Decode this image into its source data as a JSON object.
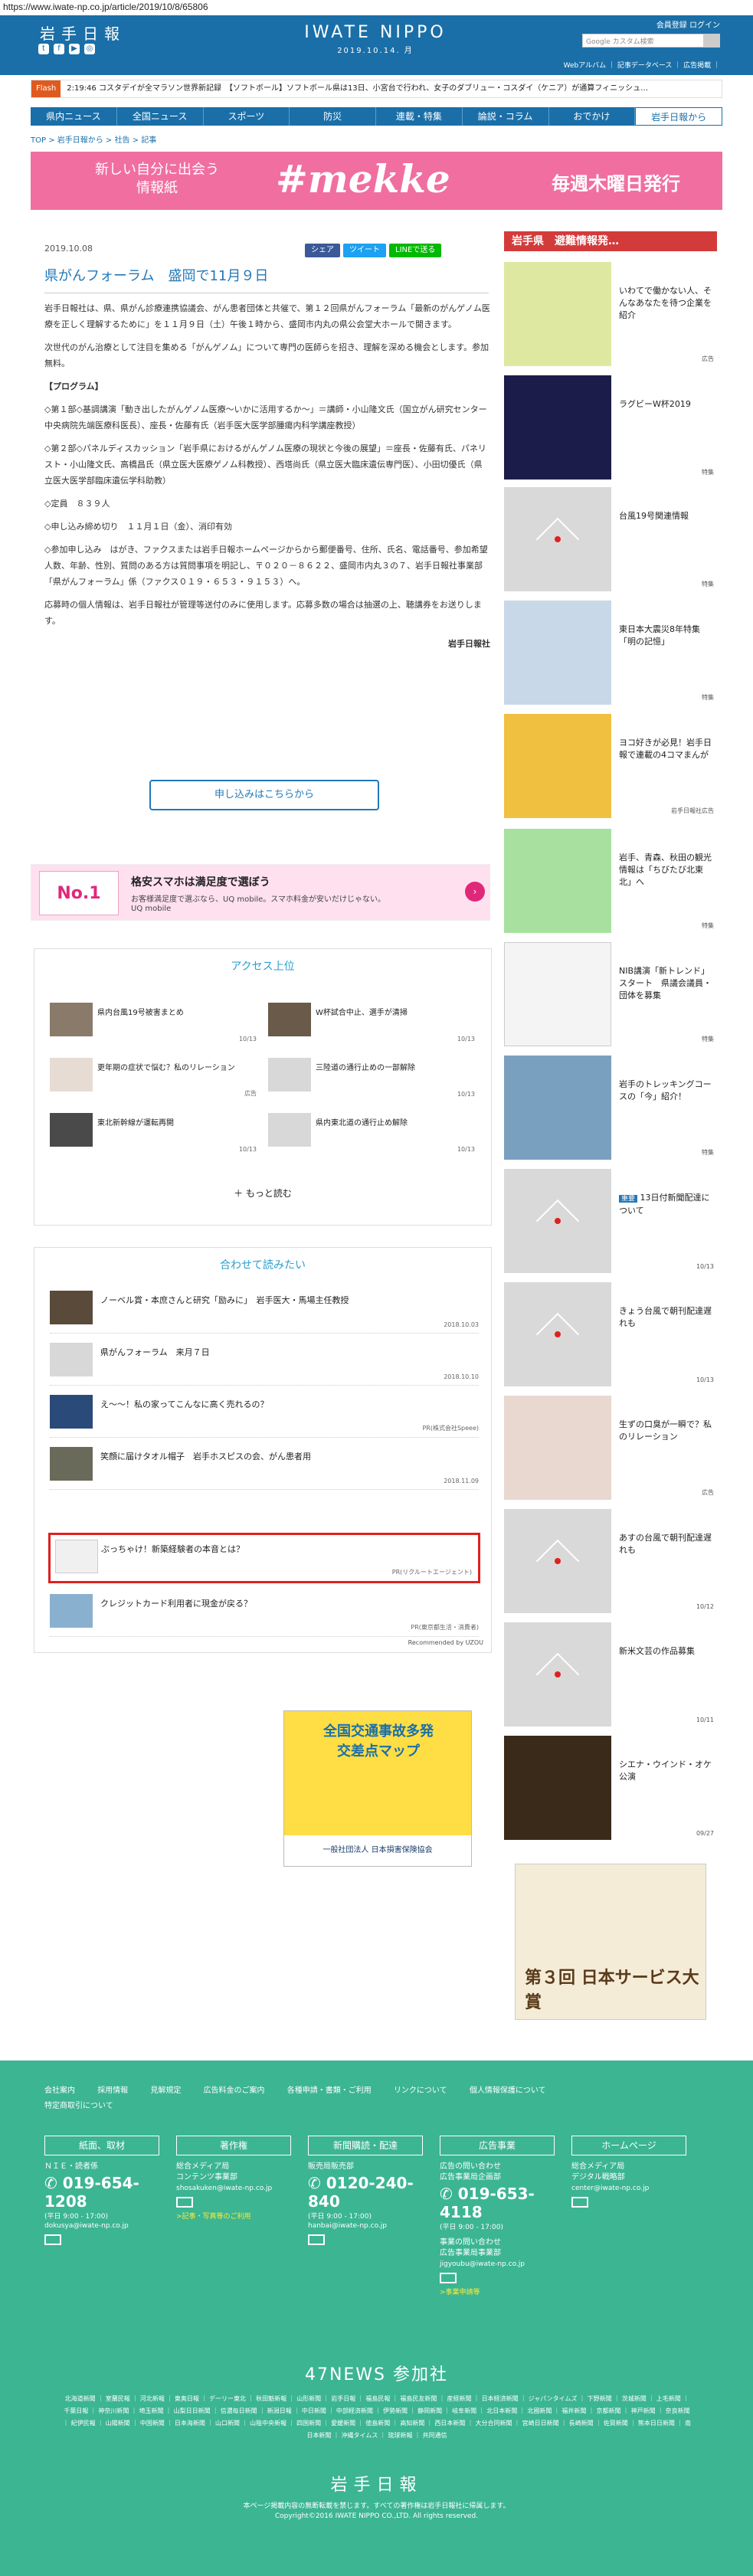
{
  "url": "https://www.iwate-np.co.jp/article/2019/10/8/65806",
  "header": {
    "logo": "岩手日報",
    "brand": "IWATE NIPPO",
    "date": "2019.10.14. 月",
    "member_links": "会員登録  ログイン",
    "search_placeholder": "Google カスタム検索",
    "sub_links": "Webアルバム ｜ 記事データベース ｜ 広告掲載 ｜"
  },
  "flash": {
    "tag": "Flash",
    "text": "2:19:46 コスタデイが全マラソン世界新記録　【ソフトボール】ソフトボール県は13日、小宮台で行われ、女子のダブリュー・コスダイ（ケニア）が通算フィニッシュ…"
  },
  "nav": [
    "県内ニュース",
    "全国ニュース",
    "スポーツ",
    "防災",
    "連載・特集",
    "論説・コラム",
    "おでかけ",
    "岩手日報から"
  ],
  "breadcrumb": "TOP > 岩手日報から > 社告 > 記事",
  "banner": {
    "left": "新しい自分に出会う\n情報紙",
    "center": "#mekke",
    "right": "毎週木曜日発行"
  },
  "article": {
    "date": "2019.10.08",
    "share": [
      "シェア",
      "ツイート",
      "LINEで送る"
    ],
    "title": "県がんフォーラム　盛岡で11月９日",
    "paragraphs": [
      "岩手日報社は、県、県がん診療連携協議会、がん患者団体と共催で、第１２回県がんフォーラム「最新のがんゲノム医療を正しく理解するために」を１１月９日（土）午後１時から、盛岡市内丸の県公会堂大ホールで開きます。",
      "次世代のがん治療として注目を集める「がんゲノム」について専門の医師らを招き、理解を深める機会とします。参加無料。",
      "【プログラム】",
      "◇第１部◇基調講演「動き出したがんゲノム医療～いかに活用するか～」＝講師・小山隆文氏（国立がん研究センター中央病院先端医療科医長）、座長・佐藤有氏（岩手医大医学部腫瘍内科学講座教授）",
      "◇第２部◇パネルディスカッション「岩手県におけるがんゲノム医療の現状と今後の展望」＝座長・佐藤有氏、パネリスト・小山隆文氏、高橋昌氏（県立医大医療ゲノム科教授）、西塔尚氏（県立医大臨床遺伝専門医）、小田切優氏（県立医大医学部臨床遺伝学科助教）",
      "◇定員　８３９人",
      "◇申し込み締め切り　１１月１日（金）、消印有効",
      "◇参加申し込み　はがき、ファクスまたは岩手日報ホームページからから郵便番号、住所、氏名、電話番号、参加希望人数、年齢、性別、質問のある方は質問事項を明記し、〒０２０－８６２２、盛岡市内丸３の７、岩手日報社事業部「県がんフォーラム」係（ファクス０１９・６５３・９１５３）へ。",
      "応募時の個人情報は、岩手日報社が管理等送付のみに使用します。応募多数の場合は抽選の上、聴講券をお送りします。"
    ],
    "source": "岩手日報社",
    "apply_button": "申し込みはこちらから"
  },
  "inline_ad": {
    "title": "格安スマホは満足度で選ぼう",
    "desc": "お客様満足度で選ぶなら、UQ mobile。スマホ料金が安いだけじゃない。",
    "brand": "UQ mobile"
  },
  "ranking": {
    "title": "アクセス上位",
    "items": [
      {
        "text": "県内台風19号被害まとめ",
        "date": "10/13"
      },
      {
        "text": "W杯試合中止、選手が清掃",
        "date": "10/13"
      },
      {
        "text": "更年期の症状で悩む？私のリレーション",
        "date": "広告"
      },
      {
        "text": "三陸道の通行止めの一部解除",
        "date": "10/13"
      },
      {
        "text": "東北新幹線が運転再開",
        "date": "10/13"
      },
      {
        "text": "県内東北道の通行止め解除",
        "date": "10/13"
      }
    ],
    "more": "もっと読む"
  },
  "related": {
    "title": "合わせて読みたい",
    "items": [
      {
        "text": "ノーベル賞・本庶さんと研究「励みに」　岩手医大・馬場主任教授",
        "date": "2018.10.03"
      },
      {
        "text": "県がんフォーラム　来月７日",
        "date": "2018.10.10"
      },
      {
        "text": "え～～！私の家ってこんなに高く売れるの？",
        "date": "PR(株式会社Speee)"
      },
      {
        "text": "笑顔に届けタオル帽子　岩手ホスピスの会、がん患者用",
        "date": "2018.11.09"
      },
      {
        "text": "ぶっちゃけ！新築経験者の本音とは？",
        "date": "PR(リクルートエージェント)"
      },
      {
        "text": "クレジットカード利用者に現金が戻る？",
        "date": "PR(東京都生活・消費者)"
      }
    ],
    "recommended": "Recommended by UZOU"
  },
  "sidebar": {
    "heading": "岩手県　避難情報発…",
    "items": [
      {
        "text": "いわてで働かない人、そんなあなたを待つ企業を紹介",
        "meta": "広告"
      },
      {
        "text": "ラグビーW杯2019",
        "meta": "特集"
      },
      {
        "text": "台風19号関連情報",
        "meta": "特集"
      },
      {
        "text": "東日本大震災8年特集「明の記憶」",
        "meta": "特集"
      },
      {
        "text": "ヨコ好きが必見！岩手日報で連載の4コマまんが",
        "meta": "岩手日報社広告"
      },
      {
        "text": "岩手、青森、秋田の観光情報は「ちびたび北東北」へ",
        "meta": "特集"
      },
      {
        "text": "NIB講演「新トレンド」スタート　県議会議員・団体を募集",
        "meta": "特集"
      },
      {
        "text": "岩手のトレッキングコースの「今」紹介！",
        "meta": "特集"
      },
      {
        "text": "13日付新聞配達について",
        "badge": "重要",
        "meta": "10/13"
      },
      {
        "text": "きょう台風で朝刊配達遅れも",
        "meta": "10/13"
      },
      {
        "text": "生ずの口臭が一瞬で？私のリレーション",
        "meta": "広告"
      },
      {
        "text": "あすの台風で朝刊配達遅れも",
        "meta": "10/12"
      },
      {
        "text": "新米文芸の作品募集",
        "meta": "10/11"
      },
      {
        "text": "シエナ・ウインド・オケ公演",
        "meta": "09/27"
      }
    ]
  },
  "bottom_ads": {
    "traffic": "全国交通事故多発\n交差点マップ",
    "traffic_sponsor": "一般社団法人 日本損害保険協会",
    "award": "第３回 日本サービス大賞"
  },
  "footer": {
    "links": [
      "会社案内",
      "採用情報",
      "見解規定",
      "広告料金のご案内",
      "各種申請・書類・ご利用",
      "リンクについて",
      "個人情報保護について",
      "特定商取引について"
    ],
    "cols": [
      {
        "head": "紙面、取材",
        "dept": "ＮＩＥ・読者係",
        "tel": "019-654-1208",
        "hours": "(平日 9:00 - 17:00)",
        "mail": "dokusya@iwate-np.co.jp"
      },
      {
        "head": "著作権",
        "dept": "総合メディア局\nコンテンツ事業部",
        "mail": "shosakuken@iwate-np.co.jp",
        "link": ">記事・写真等のご利用"
      },
      {
        "head": "新聞購読・配達",
        "dept": "販売局販売部",
        "tel": "0120-240-840",
        "hours": "(平日 9:00 - 17:00)",
        "mail": "hanbai@iwate-np.co.jp"
      },
      {
        "head": "広告事業",
        "dept": "広告の問い合わせ\n広告事業局企画部",
        "tel": "019-653-4118",
        "hours": "(平日 9:00 - 17:00)",
        "dept2": "事業の問い合わせ\n広告事業局事業部",
        "mail": "jigyoubu@iwate-np.co.jp",
        "link": ">事業申請等"
      },
      {
        "head": "ホームページ",
        "dept": "総合メディア局\nデジタル戦略部",
        "mail": "center@iwate-np.co.jp"
      }
    ],
    "title47": "47NEWS 参加社",
    "papers": "北海道新聞 ｜ 室蘭民報 ｜ 河北新報 ｜ 東奥日報 ｜ デーリー東北 ｜ 秋田魁新報 ｜ 山形新聞 ｜ 岩手日報 ｜ 福島民報 ｜ 福島民友新聞 ｜ 産経新聞 ｜ 日本経済新聞 ｜ ジャパンタイムズ ｜ 下野新聞 ｜ 茨城新聞 ｜ 上毛新聞 ｜ 千葉日報 ｜ 神奈川新聞 ｜ 埼玉新聞 ｜ 山梨日日新聞 ｜ 信濃毎日新聞 ｜ 新潟日報 ｜ 中日新聞 ｜ 中部経済新聞 ｜ 伊勢新聞 ｜ 静岡新聞 ｜ 岐阜新聞 ｜ 北日本新聞 ｜ 北國新聞 ｜ 福井新聞 ｜ 京都新聞 ｜ 神戸新聞 ｜ 奈良新聞 ｜ 紀伊民報 ｜ 山陽新聞 ｜ 中国新聞 ｜ 日本海新聞 ｜ 山口新聞 ｜ 山陰中央新報 ｜ 四国新聞 ｜ 愛媛新聞 ｜ 徳島新聞 ｜ 高知新聞 ｜ 西日本新聞 ｜ 大分合同新聞 ｜ 宮崎日日新聞 ｜ 長崎新聞 ｜ 佐賀新聞 ｜ 熊本日日新聞 ｜ 南日本新聞 ｜ 沖縄タイムス ｜ 琉球新報 ｜ 共同通信",
    "logo": "岩手日報",
    "note": "本ページ掲載内容の無断転載を禁じます。すべての著作権は岩手日報社に帰属します。",
    "copyright": "Copyright©2016 IWATE NIPPO CO.,LTD. All rights reserved."
  }
}
